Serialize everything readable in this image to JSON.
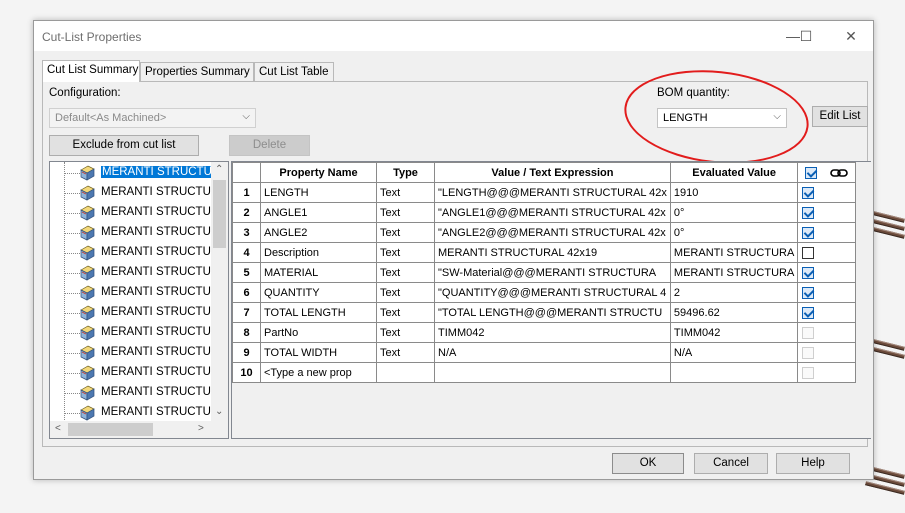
{
  "window": {
    "title": "Cut-List Properties",
    "minimize_glyph": "—",
    "maximize_glyph": "☐",
    "close_glyph": "✕"
  },
  "tabs": [
    {
      "label": "Cut List Summary",
      "active": true
    },
    {
      "label": "Properties Summary",
      "active": false
    },
    {
      "label": "Cut List Table",
      "active": false
    }
  ],
  "configuration": {
    "label": "Configuration:",
    "value": "Default<As Machined>"
  },
  "bom": {
    "label": "BOM quantity:",
    "value": "LENGTH",
    "edit_list_label": "Edit List"
  },
  "buttons": {
    "exclude": "Exclude from cut list",
    "delete": "Delete",
    "ok": "OK",
    "cancel": "Cancel",
    "help": "Help"
  },
  "tree": {
    "items": [
      "MERANTI STRUCTURAL",
      "MERANTI STRUCTURAL",
      "MERANTI STRUCTURAL",
      "MERANTI STRUCTURAL",
      "MERANTI STRUCTURAL",
      "MERANTI STRUCTURAL",
      "MERANTI STRUCTURAL",
      "MERANTI STRUCTURAL",
      "MERANTI STRUCTURAL",
      "MERANTI STRUCTURAL",
      "MERANTI STRUCTURAL",
      "MERANTI STRUCTURAL",
      "MERANTI STRUCTURAL"
    ],
    "selected_index": 0
  },
  "grid": {
    "headers": [
      "Property Name",
      "Type",
      "Value / Text Expression",
      "Evaluated Value"
    ],
    "rows": [
      {
        "num": "1",
        "name": "LENGTH",
        "type": "Text",
        "value": "\"LENGTH@@@MERANTI STRUCTURAL 42x",
        "evaluated": "1910",
        "checked": true,
        "enabled": true
      },
      {
        "num": "2",
        "name": "ANGLE1",
        "type": "Text",
        "value": "\"ANGLE1@@@MERANTI STRUCTURAL 42x",
        "evaluated": "0°",
        "checked": true,
        "enabled": true
      },
      {
        "num": "3",
        "name": "ANGLE2",
        "type": "Text",
        "value": "\"ANGLE2@@@MERANTI STRUCTURAL 42x",
        "evaluated": "0°",
        "checked": true,
        "enabled": true
      },
      {
        "num": "4",
        "name": "Description",
        "type": "Text",
        "value": "MERANTI STRUCTURAL 42x19",
        "evaluated": "MERANTI STRUCTURA",
        "checked": false,
        "enabled": true
      },
      {
        "num": "5",
        "name": "MATERIAL",
        "type": "Text",
        "value": "\"SW-Material@@@MERANTI STRUCTURA",
        "evaluated": "MERANTI STRUCTURA",
        "checked": true,
        "enabled": true
      },
      {
        "num": "6",
        "name": "QUANTITY",
        "type": "Text",
        "value": "\"QUANTITY@@@MERANTI STRUCTURAL 4",
        "evaluated": "2",
        "checked": true,
        "enabled": true
      },
      {
        "num": "7",
        "name": "TOTAL LENGTH",
        "type": "Text",
        "value": "\"TOTAL LENGTH@@@MERANTI STRUCTU",
        "evaluated": "59496.62",
        "checked": true,
        "enabled": true
      },
      {
        "num": "8",
        "name": "PartNo",
        "type": "Text",
        "value": "TIMM042",
        "evaluated": "TIMM042",
        "checked": false,
        "enabled": false
      },
      {
        "num": "9",
        "name": "TOTAL WIDTH",
        "type": "Text",
        "value": "N/A",
        "evaluated": "N/A",
        "checked": false,
        "enabled": false
      },
      {
        "num": "10",
        "name": "<Type a new prop",
        "type": "",
        "value": "",
        "evaluated": "",
        "checked": false,
        "enabled": false
      }
    ]
  },
  "icons": {
    "part": "weldment-part-icon",
    "link": "link-icon",
    "header_check": "checkbox-icon"
  },
  "colors": {
    "selection": "#0078d7",
    "annotation": "#e21c1c",
    "checkbox": "#0a5fb4"
  }
}
